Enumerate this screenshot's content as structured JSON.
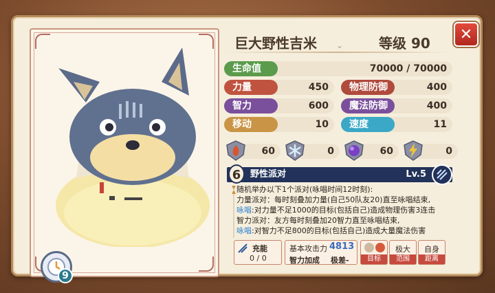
{
  "monster": {
    "name": "巨大野性吉米",
    "level_label": "等级 90"
  },
  "cooldown": {
    "value": "9",
    "icon": "clock-icon"
  },
  "stats": {
    "hp": {
      "label": "生命值",
      "value": "70000 / 70000",
      "color": "#5a9b4c"
    },
    "atk": {
      "label": "力量",
      "value": "450",
      "color": "#c0533f"
    },
    "pdef": {
      "label": "物理防御",
      "value": "400",
      "color": "#b04a3c"
    },
    "int": {
      "label": "智力",
      "value": "600",
      "color": "#7a4f9c"
    },
    "mdef": {
      "label": "魔法防御",
      "value": "400",
      "color": "#7a4f9c"
    },
    "move": {
      "label": "移动",
      "value": "10",
      "color": "#c99445"
    },
    "spd": {
      "label": "速度",
      "value": "11",
      "color": "#3aa8c6"
    }
  },
  "resistances": [
    {
      "icon": "fire-shield-icon",
      "value": "60",
      "color": "#d9552e"
    },
    {
      "icon": "ice-shield-icon",
      "value": "0",
      "color": "#8ec7e6"
    },
    {
      "icon": "dark-shield-icon",
      "value": "60",
      "color": "#7a3fc4"
    },
    {
      "icon": "thunder-shield-icon",
      "value": "0",
      "color": "#e8b93a"
    }
  ],
  "skill": {
    "cooldown": "6",
    "name": "野性派对",
    "level": "Lv.5",
    "desc": [
      {
        "prefix": "",
        "text": "随机举办以下1个派对(咏唱时间12时刻):"
      },
      {
        "prefix": "",
        "text": "力量派对：每时刻叠加力量(自己50队友20)直至咏唱结束,"
      },
      {
        "prefix": "咏唱",
        "text": ":对力量不足1000的目标(包括自己)造成物理伤害3连击"
      },
      {
        "prefix": "",
        "text": "智力派对：友方每时刻叠加20智力直至咏唱结束,"
      },
      {
        "prefix": "咏唱",
        "text": ":对智力不足800的目标(包括自己)造成大量魔法伤害"
      }
    ]
  },
  "bottom": {
    "charge_label": "充能",
    "charge_value": "0 / 0",
    "base_atk_label": "基本攻击力",
    "base_atk_value": "4813",
    "int_bonus_label": "智力加成",
    "int_bonus_value": "极差-",
    "target_label": "目标",
    "range_value": "极大",
    "range_label": "范围",
    "distance_value": "自身",
    "distance_label": "距离"
  }
}
